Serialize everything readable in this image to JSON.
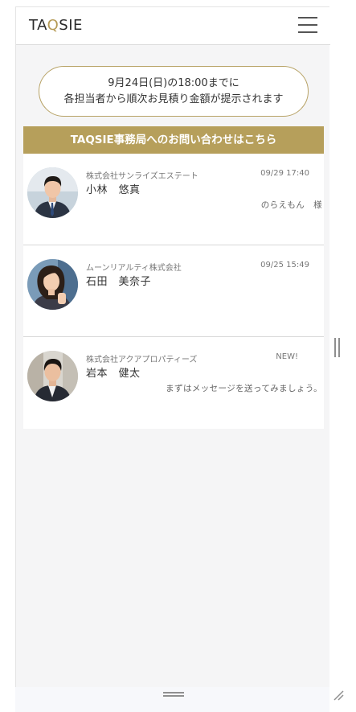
{
  "header": {
    "logo_prefix": "TA",
    "logo_q": "Q",
    "logo_suffix": "SIE",
    "menu_icon": "hamburger-menu-icon"
  },
  "notice": {
    "line1": "9月24日(日)の18:00までに",
    "line2": "各担当者から順次お見積り金額が提示されます"
  },
  "contact": {
    "label": "TAQSIE事務局へのお問い合わせはこちら"
  },
  "messages": [
    {
      "company": "株式会社サンライズエステート",
      "time": "09/29 17:40",
      "name": "小林　悠真",
      "preview": "のらえもん　様"
    },
    {
      "company": "ムーンリアルティ株式会社",
      "time": "09/25 15:49",
      "name": "石田　美奈子",
      "preview": ""
    },
    {
      "company": "株式会社アクアプロパティーズ",
      "time": "NEW!",
      "name": "岩本　健太",
      "preview": "まずはメッセージを送ってみましょう。"
    }
  ],
  "colors": {
    "brand_gold": "#b69f5b",
    "notice_border": "#b8a367",
    "background": "#f5f5f6"
  }
}
